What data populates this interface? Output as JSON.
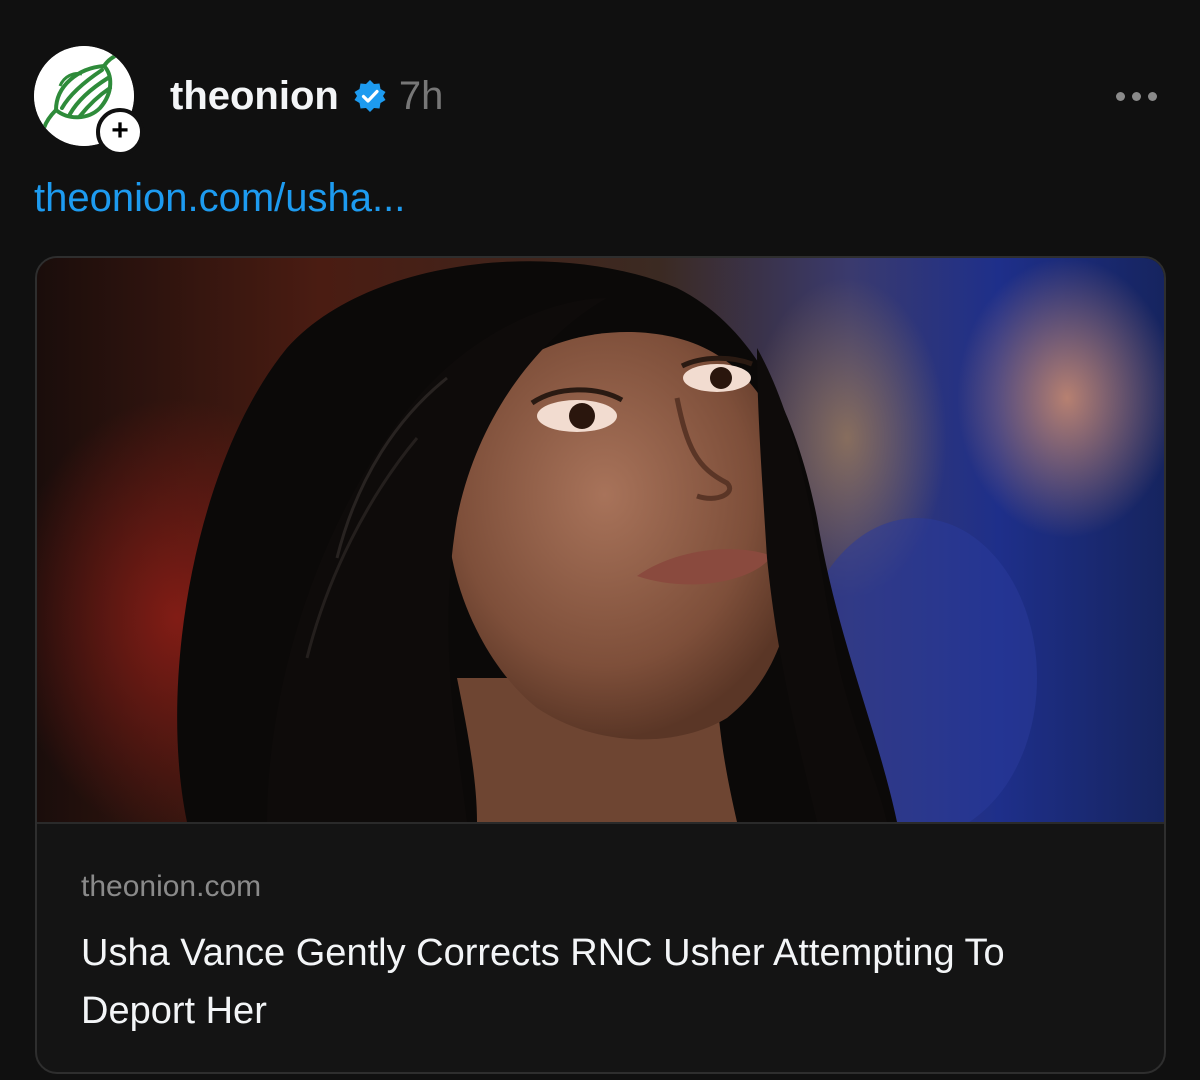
{
  "post": {
    "author": {
      "username": "theonion",
      "avatar_icon": "onion-logo-icon",
      "follow_symbol": "+",
      "verified_icon": "verified-badge-icon"
    },
    "timestamp": "7h",
    "more_icon": "more-options-icon",
    "link_text": "theonion.com/usha...",
    "link_card": {
      "image_alt": "Photo of a woman with long dark hair looking up, blurred crowd in background",
      "domain": "theonion.com",
      "headline": "Usha Vance Gently Corrects RNC Usher Attempting To Deport Her"
    }
  },
  "colors": {
    "background": "#101010",
    "link_blue": "#1d9bf0",
    "verified_blue": "#1d9bf0",
    "muted_text": "#777777",
    "onion_green": "#2e8b3a"
  }
}
